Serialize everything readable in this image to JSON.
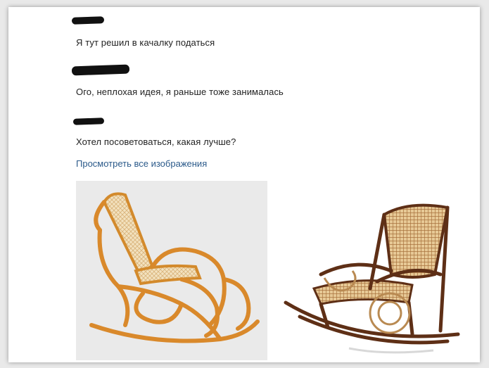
{
  "messages": [
    {
      "text": "Я тут решил в качалку податься"
    },
    {
      "text": "Ого, неплохая идея, я раньше тоже занималась"
    },
    {
      "text": "Хотел посоветоваться, какая лучше?"
    }
  ],
  "view_all_images_link": "Просмотреть все изображения",
  "colors": {
    "link": "#2b5a8a",
    "text": "#222222",
    "redaction": "#111111"
  }
}
